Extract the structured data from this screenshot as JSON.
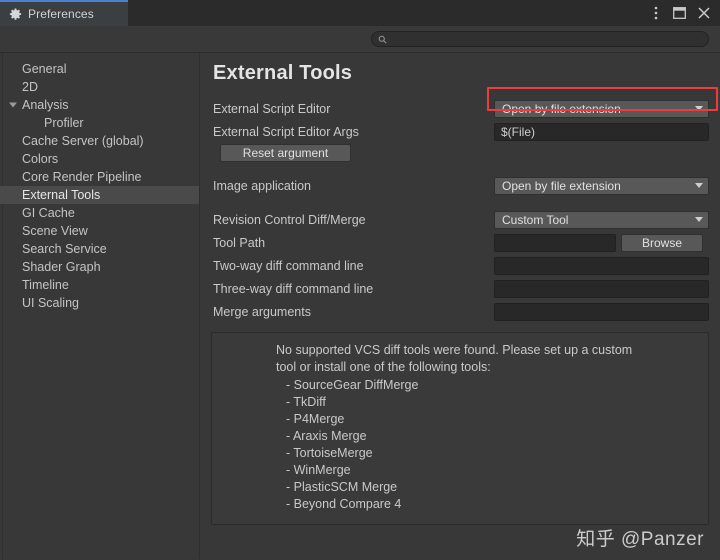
{
  "window": {
    "tab_label": "Preferences",
    "tab_icon": "gear-icon",
    "controls": [
      {
        "name": "more-options-icon",
        "label": "⋮"
      },
      {
        "name": "maximize-icon",
        "label": "□"
      },
      {
        "name": "close-icon",
        "label": "✕"
      }
    ],
    "accent_color": "#4b7fd4"
  },
  "search": {
    "icon": "search-icon",
    "value": "",
    "placeholder": ""
  },
  "sidebar": {
    "items": [
      {
        "label": "General",
        "selected": false,
        "child": false,
        "foldout": false
      },
      {
        "label": "2D",
        "selected": false,
        "child": false,
        "foldout": false
      },
      {
        "label": "Analysis",
        "selected": false,
        "child": false,
        "foldout": true
      },
      {
        "label": "Profiler",
        "selected": false,
        "child": true,
        "foldout": false
      },
      {
        "label": "Cache Server (global)",
        "selected": false,
        "child": false,
        "foldout": false
      },
      {
        "label": "Colors",
        "selected": false,
        "child": false,
        "foldout": false
      },
      {
        "label": "Core Render Pipeline",
        "selected": false,
        "child": false,
        "foldout": false
      },
      {
        "label": "External Tools",
        "selected": true,
        "child": false,
        "foldout": false
      },
      {
        "label": "GI Cache",
        "selected": false,
        "child": false,
        "foldout": false
      },
      {
        "label": "Scene View",
        "selected": false,
        "child": false,
        "foldout": false
      },
      {
        "label": "Search Service",
        "selected": false,
        "child": false,
        "foldout": false
      },
      {
        "label": "Shader Graph",
        "selected": false,
        "child": false,
        "foldout": false
      },
      {
        "label": "Timeline",
        "selected": false,
        "child": false,
        "foldout": false
      },
      {
        "label": "UI Scaling",
        "selected": false,
        "child": false,
        "foldout": false
      }
    ]
  },
  "content": {
    "title": "External Tools",
    "rows": {
      "external_script_editor": {
        "label": "External Script Editor",
        "value": "Open by file extension",
        "highlighted": true,
        "highlight_color": "#ef3b3b"
      },
      "external_script_editor_args": {
        "label": "External Script Editor Args",
        "value": "$(File)"
      },
      "reset_argument": {
        "label": "Reset argument"
      },
      "image_application": {
        "label": "Image application",
        "value": "Open by file extension"
      },
      "revision_control": {
        "label": "Revision Control Diff/Merge",
        "value": "Custom Tool"
      },
      "tool_path": {
        "label": "Tool Path",
        "value": "",
        "browse_label": "Browse"
      },
      "two_way_diff": {
        "label": "Two-way diff command line",
        "value": ""
      },
      "three_way_diff": {
        "label": "Three-way diff command line",
        "value": ""
      },
      "merge_arguments": {
        "label": "Merge arguments",
        "value": ""
      }
    },
    "helpbox": {
      "line1": "No supported VCS diff tools were found. Please set up a custom",
      "line2": "tool or install one of the following tools:",
      "tools": [
        "- SourceGear DiffMerge",
        "- TkDiff",
        "- P4Merge",
        "- Araxis Merge",
        "- TortoiseMerge",
        "- WinMerge",
        "- PlasticSCM Merge",
        "- Beyond Compare 4"
      ]
    }
  },
  "watermark": {
    "text": "知乎 @Panzer"
  }
}
